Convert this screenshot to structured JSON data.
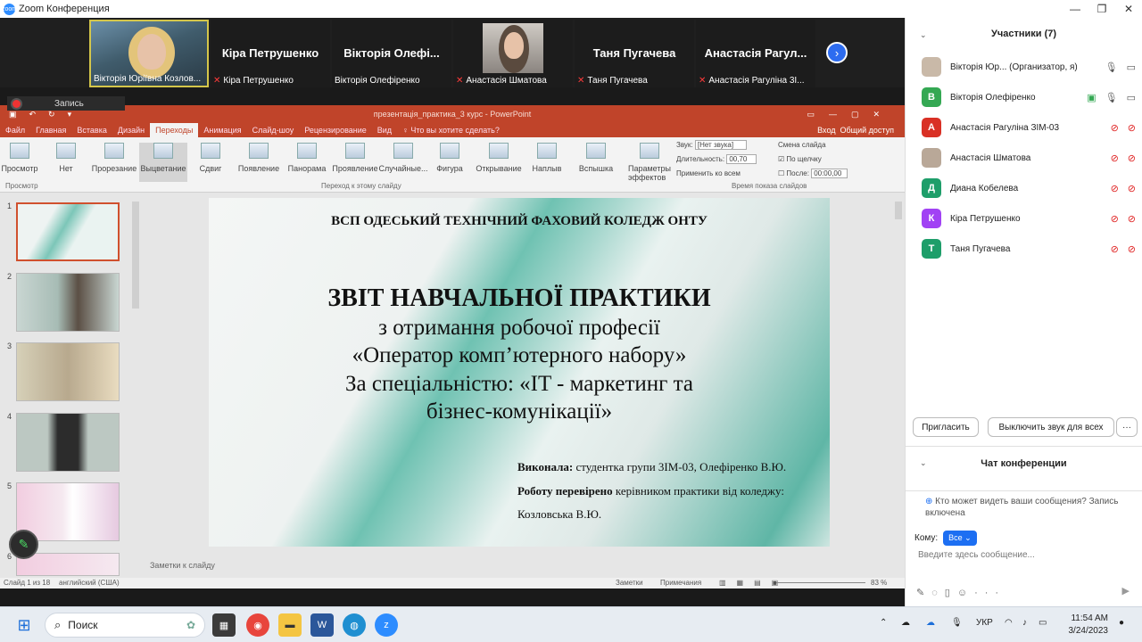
{
  "window": {
    "title": "Zoom Конференция",
    "app_icon": "zoom-logo",
    "minimize": "—",
    "restore": "❐",
    "close": "✕"
  },
  "gallery": {
    "tiles": [
      {
        "name": "",
        "label": "Вікторія Юріївна Козлов...",
        "muted": false,
        "video": true
      },
      {
        "name": "Кіра Петрушенко",
        "label": "Кіра Петрушенко",
        "muted": true,
        "video": false
      },
      {
        "name": "Вікторія Олефі...",
        "label": "Вікторія Олефіренко",
        "muted": false,
        "video": false
      },
      {
        "name": "",
        "label": "Анастасія Шматова",
        "muted": true,
        "video": true
      },
      {
        "name": "Таня Пугачева",
        "label": "Таня Пугачева",
        "muted": true,
        "video": false
      },
      {
        "name": "Анастасія Рагул...",
        "label": "Анастасія Рагуліна 3І...",
        "muted": true,
        "video": false
      }
    ],
    "next_icon": "›"
  },
  "recording": {
    "label": "Запись"
  },
  "ppt": {
    "doc_title": "презентація_практика_3 курс - PowerPoint",
    "tabs": [
      "Файл",
      "Главная",
      "Вставка",
      "Дизайн",
      "Переходы",
      "Анимация",
      "Слайд-шоу",
      "Рецензирование",
      "Вид"
    ],
    "active_tab": "Переходы",
    "tell_me": "Что вы хотите сделать?",
    "signin": "Вход",
    "share": "Общий доступ",
    "ribbon": {
      "preview": "Просмотр",
      "transitions": [
        "Нет",
        "Прорезание",
        "Выцветание",
        "Сдвиг",
        "Появление",
        "Панорама",
        "Проявление",
        "Случайные...",
        "Фигура",
        "Открывание",
        "Наплыв",
        "Вспышка"
      ],
      "selected": "Выцветание",
      "effects": "Параметры эффектов",
      "sound_label": "Звук:",
      "sound_value": "[Нет звука]",
      "duration_label": "Длительность:",
      "duration_value": "00,70",
      "apply_all": "Применить ко всем",
      "advance": "Смена слайда",
      "on_click": "По щелчку",
      "after_label": "После:",
      "after_value": "00:00,00",
      "group_preview": "Просмотр",
      "group_transition": "Переход к этому слайду",
      "group_timing": "Время показа слайдов"
    },
    "slide": {
      "header": "ВСП ОДЕСЬКИЙ ТЕХНІЧНИЙ ФАХОВИЙ КОЛЕДЖ ОНТУ",
      "title": "ЗВІТ НАВЧАЛЬНОЇ ПРАКТИКИ",
      "line1": "з отримання робочої професії",
      "line2": "«Оператор комп’ютерного набору»",
      "line3": "За спеціальністю: «IT - маркетинг та",
      "line4": "бізнес-комунікації»",
      "done_label": "Виконала:",
      "done_text": " студентка групи 3ІМ-03, Олефіренко В.Ю.",
      "checked_label": "Роботу перевірено",
      "checked_text": " керівником практики від коледжу:",
      "checker": "Козловська В.Ю."
    },
    "thumbs": [
      "1",
      "2",
      "3",
      "4",
      "5",
      "6"
    ],
    "notes": "Заметки к слайду",
    "status": {
      "slide": "Слайд 1 из 18",
      "lang": "английский (США)",
      "notes_btn": "Заметки",
      "comments_btn": "Примечания",
      "zoom": "83 %"
    }
  },
  "participants": {
    "header": "Участники (7)",
    "list": [
      {
        "initial": "",
        "name": "Вікторія Юр... (Организатор, я)",
        "color": "#c9b9a8",
        "photo": true,
        "muted": false
      },
      {
        "initial": "В",
        "name": "Вікторія Олефіренко",
        "color": "#34a853",
        "photo": false,
        "muted": false
      },
      {
        "initial": "А",
        "name": "Анастасія Рагуліна ЗІМ-03",
        "color": "#d93025",
        "photo": false,
        "muted": true
      },
      {
        "initial": "",
        "name": "Анастасія Шматова",
        "color": "#b9a898",
        "photo": true,
        "muted": true
      },
      {
        "initial": "Д",
        "name": "Диана Кобелева",
        "color": "#1e9e6a",
        "photo": false,
        "muted": true
      },
      {
        "initial": "К",
        "name": "Кіра Петрушенко",
        "color": "#a142f4",
        "photo": false,
        "muted": true
      },
      {
        "initial": "Т",
        "name": "Таня Пугачева",
        "color": "#1e9e6a",
        "photo": false,
        "muted": true
      }
    ],
    "invite": "Пригласить",
    "mute_all": "Выключить звук для всех",
    "more": "···"
  },
  "chat": {
    "header": "Чат конференции",
    "info": "Кто может видеть ваши сообщения? Запись включена",
    "to_label": "Кому:",
    "to_value": "Все",
    "placeholder": "Введите здесь сообщение..."
  },
  "taskbar": {
    "search": "Поиск",
    "lang": "УКР",
    "time": "11:54 AM",
    "date": "3/24/2023"
  }
}
